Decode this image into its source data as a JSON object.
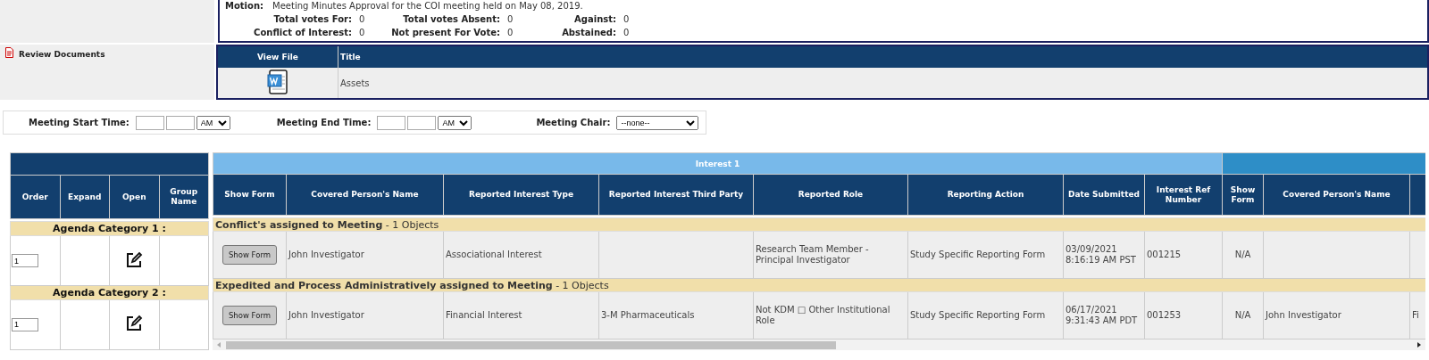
{
  "motion": {
    "label": "Motion:",
    "text": "Meeting Minutes Approval for the COI meeting held on May 08, 2019.",
    "votes": [
      {
        "label": "Total votes For:",
        "value": "0"
      },
      {
        "label": "Total votes Absent:",
        "value": "0"
      },
      {
        "label": "Against:",
        "value": "0"
      },
      {
        "label": "Conflict of Interest:",
        "value": "0"
      },
      {
        "label": "Not present For Vote:",
        "value": "0"
      },
      {
        "label": "Abstained:",
        "value": "0"
      }
    ]
  },
  "review_documents": {
    "label": "Review Documents",
    "columns": [
      "View File",
      "Title"
    ],
    "rows": [
      {
        "title": "Assets"
      }
    ]
  },
  "meeting": {
    "start_label": "Meeting Start Time:",
    "start_ampm": "AM",
    "end_label": "Meeting End Time:",
    "end_ampm": "AM",
    "chair_label": "Meeting Chair:",
    "chair_value": "--none--"
  },
  "agenda": {
    "left_columns": [
      "Order",
      "Expand",
      "Open",
      "Group Name"
    ],
    "group_header": "Interest 1",
    "columns": [
      "Show Form",
      "Covered Person's Name",
      "Reported Interest Type",
      "Reported Interest Third Party",
      "Reported Role",
      "Reporting Action",
      "Date Submitted",
      "Interest Ref Number",
      "Show Form",
      "Covered Person's Name"
    ],
    "categories": [
      {
        "name": "Agenda Category 1 :",
        "group_title": "**Conflict's assigned to Meeting** - 1 Objects",
        "rows": [
          {
            "order": "1",
            "cells": [
              "Show Form",
              "John Investigator",
              "Associational Interest",
              null,
              "Research Team Member - Principal Investigator",
              "Study Specific Reporting Form",
              [
                "03/09/2021",
                "8:16:19 AM PST"
              ],
              "001215",
              "N/A",
              null,
              null
            ]
          }
        ]
      },
      {
        "name": "Agenda Category 2 :",
        "group_title": "**Expedited and Process Administratively assigned to Meeting** - 1 Objects",
        "rows": [
          {
            "order": "1",
            "cells": [
              "Show Form",
              "John Investigator",
              "Financial Interest",
              "3-M Pharmaceuticals",
              "Not KDM □ Other Institutional Role",
              "Study Specific Reporting Form",
              [
                "06/17/2021",
                "9:31:43 AM PDT"
              ],
              "001253",
              "N/A",
              "John Investigator",
              "Fi"
            ]
          }
        ]
      }
    ]
  }
}
